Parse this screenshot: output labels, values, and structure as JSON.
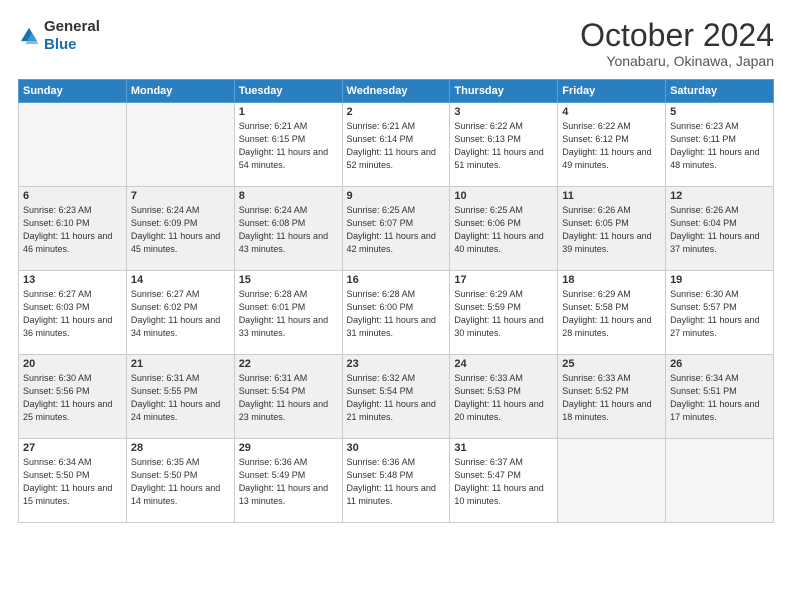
{
  "logo": {
    "general": "General",
    "blue": "Blue"
  },
  "header": {
    "month": "October 2024",
    "location": "Yonabaru, Okinawa, Japan"
  },
  "weekdays": [
    "Sunday",
    "Monday",
    "Tuesday",
    "Wednesday",
    "Thursday",
    "Friday",
    "Saturday"
  ],
  "weeks": [
    [
      {
        "day": "",
        "sunrise": "",
        "sunset": "",
        "daylight": ""
      },
      {
        "day": "",
        "sunrise": "",
        "sunset": "",
        "daylight": ""
      },
      {
        "day": "1",
        "sunrise": "Sunrise: 6:21 AM",
        "sunset": "Sunset: 6:15 PM",
        "daylight": "Daylight: 11 hours and 54 minutes."
      },
      {
        "day": "2",
        "sunrise": "Sunrise: 6:21 AM",
        "sunset": "Sunset: 6:14 PM",
        "daylight": "Daylight: 11 hours and 52 minutes."
      },
      {
        "day": "3",
        "sunrise": "Sunrise: 6:22 AM",
        "sunset": "Sunset: 6:13 PM",
        "daylight": "Daylight: 11 hours and 51 minutes."
      },
      {
        "day": "4",
        "sunrise": "Sunrise: 6:22 AM",
        "sunset": "Sunset: 6:12 PM",
        "daylight": "Daylight: 11 hours and 49 minutes."
      },
      {
        "day": "5",
        "sunrise": "Sunrise: 6:23 AM",
        "sunset": "Sunset: 6:11 PM",
        "daylight": "Daylight: 11 hours and 48 minutes."
      }
    ],
    [
      {
        "day": "6",
        "sunrise": "Sunrise: 6:23 AM",
        "sunset": "Sunset: 6:10 PM",
        "daylight": "Daylight: 11 hours and 46 minutes."
      },
      {
        "day": "7",
        "sunrise": "Sunrise: 6:24 AM",
        "sunset": "Sunset: 6:09 PM",
        "daylight": "Daylight: 11 hours and 45 minutes."
      },
      {
        "day": "8",
        "sunrise": "Sunrise: 6:24 AM",
        "sunset": "Sunset: 6:08 PM",
        "daylight": "Daylight: 11 hours and 43 minutes."
      },
      {
        "day": "9",
        "sunrise": "Sunrise: 6:25 AM",
        "sunset": "Sunset: 6:07 PM",
        "daylight": "Daylight: 11 hours and 42 minutes."
      },
      {
        "day": "10",
        "sunrise": "Sunrise: 6:25 AM",
        "sunset": "Sunset: 6:06 PM",
        "daylight": "Daylight: 11 hours and 40 minutes."
      },
      {
        "day": "11",
        "sunrise": "Sunrise: 6:26 AM",
        "sunset": "Sunset: 6:05 PM",
        "daylight": "Daylight: 11 hours and 39 minutes."
      },
      {
        "day": "12",
        "sunrise": "Sunrise: 6:26 AM",
        "sunset": "Sunset: 6:04 PM",
        "daylight": "Daylight: 11 hours and 37 minutes."
      }
    ],
    [
      {
        "day": "13",
        "sunrise": "Sunrise: 6:27 AM",
        "sunset": "Sunset: 6:03 PM",
        "daylight": "Daylight: 11 hours and 36 minutes."
      },
      {
        "day": "14",
        "sunrise": "Sunrise: 6:27 AM",
        "sunset": "Sunset: 6:02 PM",
        "daylight": "Daylight: 11 hours and 34 minutes."
      },
      {
        "day": "15",
        "sunrise": "Sunrise: 6:28 AM",
        "sunset": "Sunset: 6:01 PM",
        "daylight": "Daylight: 11 hours and 33 minutes."
      },
      {
        "day": "16",
        "sunrise": "Sunrise: 6:28 AM",
        "sunset": "Sunset: 6:00 PM",
        "daylight": "Daylight: 11 hours and 31 minutes."
      },
      {
        "day": "17",
        "sunrise": "Sunrise: 6:29 AM",
        "sunset": "Sunset: 5:59 PM",
        "daylight": "Daylight: 11 hours and 30 minutes."
      },
      {
        "day": "18",
        "sunrise": "Sunrise: 6:29 AM",
        "sunset": "Sunset: 5:58 PM",
        "daylight": "Daylight: 11 hours and 28 minutes."
      },
      {
        "day": "19",
        "sunrise": "Sunrise: 6:30 AM",
        "sunset": "Sunset: 5:57 PM",
        "daylight": "Daylight: 11 hours and 27 minutes."
      }
    ],
    [
      {
        "day": "20",
        "sunrise": "Sunrise: 6:30 AM",
        "sunset": "Sunset: 5:56 PM",
        "daylight": "Daylight: 11 hours and 25 minutes."
      },
      {
        "day": "21",
        "sunrise": "Sunrise: 6:31 AM",
        "sunset": "Sunset: 5:55 PM",
        "daylight": "Daylight: 11 hours and 24 minutes."
      },
      {
        "day": "22",
        "sunrise": "Sunrise: 6:31 AM",
        "sunset": "Sunset: 5:54 PM",
        "daylight": "Daylight: 11 hours and 23 minutes."
      },
      {
        "day": "23",
        "sunrise": "Sunrise: 6:32 AM",
        "sunset": "Sunset: 5:54 PM",
        "daylight": "Daylight: 11 hours and 21 minutes."
      },
      {
        "day": "24",
        "sunrise": "Sunrise: 6:33 AM",
        "sunset": "Sunset: 5:53 PM",
        "daylight": "Daylight: 11 hours and 20 minutes."
      },
      {
        "day": "25",
        "sunrise": "Sunrise: 6:33 AM",
        "sunset": "Sunset: 5:52 PM",
        "daylight": "Daylight: 11 hours and 18 minutes."
      },
      {
        "day": "26",
        "sunrise": "Sunrise: 6:34 AM",
        "sunset": "Sunset: 5:51 PM",
        "daylight": "Daylight: 11 hours and 17 minutes."
      }
    ],
    [
      {
        "day": "27",
        "sunrise": "Sunrise: 6:34 AM",
        "sunset": "Sunset: 5:50 PM",
        "daylight": "Daylight: 11 hours and 15 minutes."
      },
      {
        "day": "28",
        "sunrise": "Sunrise: 6:35 AM",
        "sunset": "Sunset: 5:50 PM",
        "daylight": "Daylight: 11 hours and 14 minutes."
      },
      {
        "day": "29",
        "sunrise": "Sunrise: 6:36 AM",
        "sunset": "Sunset: 5:49 PM",
        "daylight": "Daylight: 11 hours and 13 minutes."
      },
      {
        "day": "30",
        "sunrise": "Sunrise: 6:36 AM",
        "sunset": "Sunset: 5:48 PM",
        "daylight": "Daylight: 11 hours and 11 minutes."
      },
      {
        "day": "31",
        "sunrise": "Sunrise: 6:37 AM",
        "sunset": "Sunset: 5:47 PM",
        "daylight": "Daylight: 11 hours and 10 minutes."
      },
      {
        "day": "",
        "sunrise": "",
        "sunset": "",
        "daylight": ""
      },
      {
        "day": "",
        "sunrise": "",
        "sunset": "",
        "daylight": ""
      }
    ]
  ]
}
